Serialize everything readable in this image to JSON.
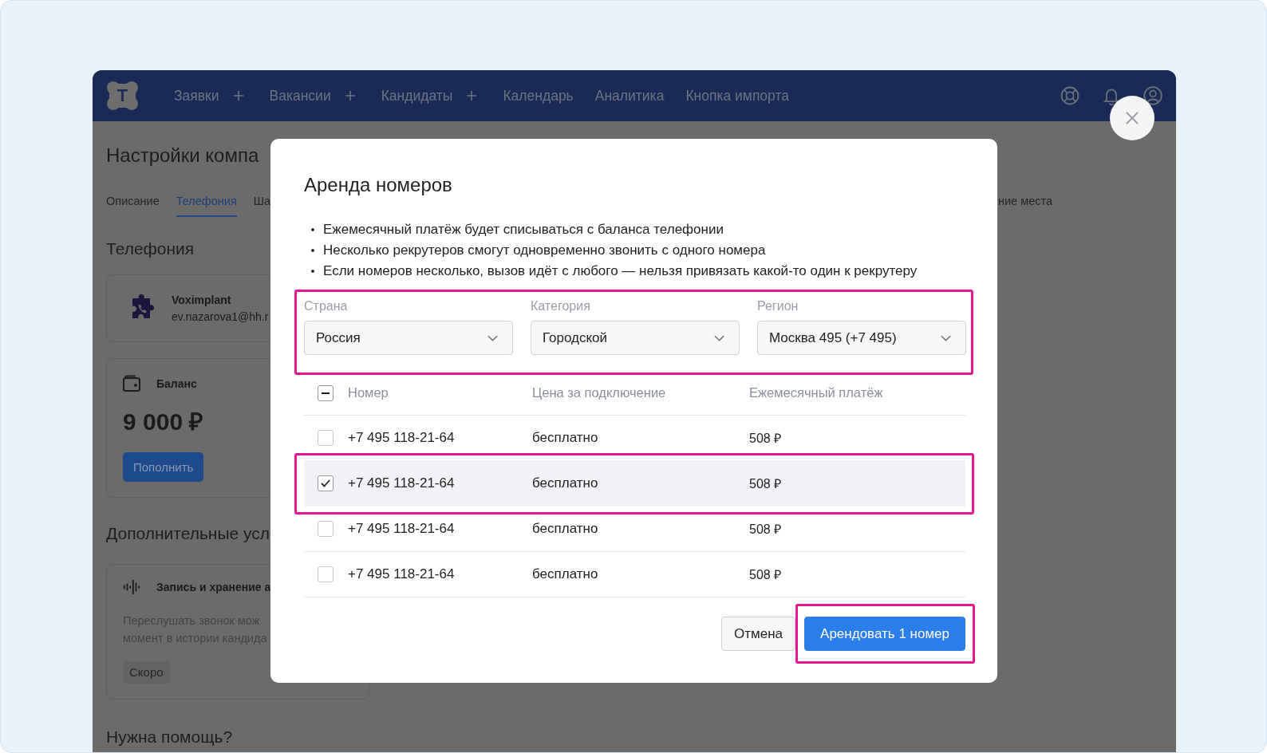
{
  "nav": {
    "logo_letter": "T",
    "items": [
      {
        "label": "Заявки",
        "has_add": true
      },
      {
        "label": "Вакансии",
        "has_add": true
      },
      {
        "label": "Кандидаты",
        "has_add": true
      },
      {
        "label": "Календарь",
        "has_add": false
      },
      {
        "label": "Аналитика",
        "has_add": false
      },
      {
        "label": "Кнопка импорта",
        "has_add": false
      }
    ]
  },
  "page": {
    "title": "Настройки компа",
    "tabs": [
      {
        "label": "Описание",
        "selected": false
      },
      {
        "label": "Телефония",
        "selected": true
      },
      {
        "label": "Ша",
        "selected": false
      },
      {
        "label": "ние места",
        "selected": false
      }
    ],
    "section_title": "Телефония",
    "provider": {
      "name": "Voximplant",
      "account": "ev.nazarova1@hh.r"
    },
    "balance": {
      "label": "Баланс",
      "amount": "9 000 ₽",
      "button": "Пополнить"
    },
    "extra_title": "Дополнительные усл",
    "extra_card": {
      "title": "Запись и хранение а",
      "description": [
        "Переслушать звонок мож",
        "момент в истории кандида"
      ],
      "badge": "Скоро"
    },
    "help_title": "Нужна помощь?"
  },
  "modal": {
    "title": "Аренда номеров",
    "notes": [
      "Ежемесячный платёж будет списываться с баланса телефонии",
      "Несколько рекрутеров смогут одновременно звонить с одного номера",
      "Если номеров несколько, вызов идёт с любого — нельзя привязать какой-то один к рекрутеру"
    ],
    "filters": {
      "highlighted": true,
      "fields": [
        {
          "label": "Страна",
          "value": "Россия"
        },
        {
          "label": "Категория",
          "value": "Городской"
        },
        {
          "label": "Регион",
          "value": "Москва 495 (+7 495)"
        }
      ]
    },
    "table": {
      "select_all_indeterminate": true,
      "columns": [
        "Номер",
        "Цена за подключение",
        "Ежемесячный платёж"
      ],
      "rows": [
        {
          "number": "+7 495 118-21-64",
          "price": "бесплатно",
          "monthly": "508 ₽",
          "selected": false,
          "highlighted": false
        },
        {
          "number": "+7 495 118-21-64",
          "price": "бесплатно",
          "monthly": "508 ₽",
          "selected": true,
          "highlighted": true
        },
        {
          "number": "+7 495 118-21-64",
          "price": "бесплатно",
          "monthly": "508 ₽",
          "selected": false,
          "highlighted": false
        },
        {
          "number": "+7 495 118-21-64",
          "price": "бесплатно",
          "monthly": "508 ₽",
          "selected": false,
          "highlighted": false
        }
      ]
    },
    "actions": [
      {
        "label": "Отмена",
        "kind": "secondary",
        "highlighted": false
      },
      {
        "label": "Арендовать 1 номер",
        "kind": "primary",
        "highlighted": true
      }
    ]
  }
}
